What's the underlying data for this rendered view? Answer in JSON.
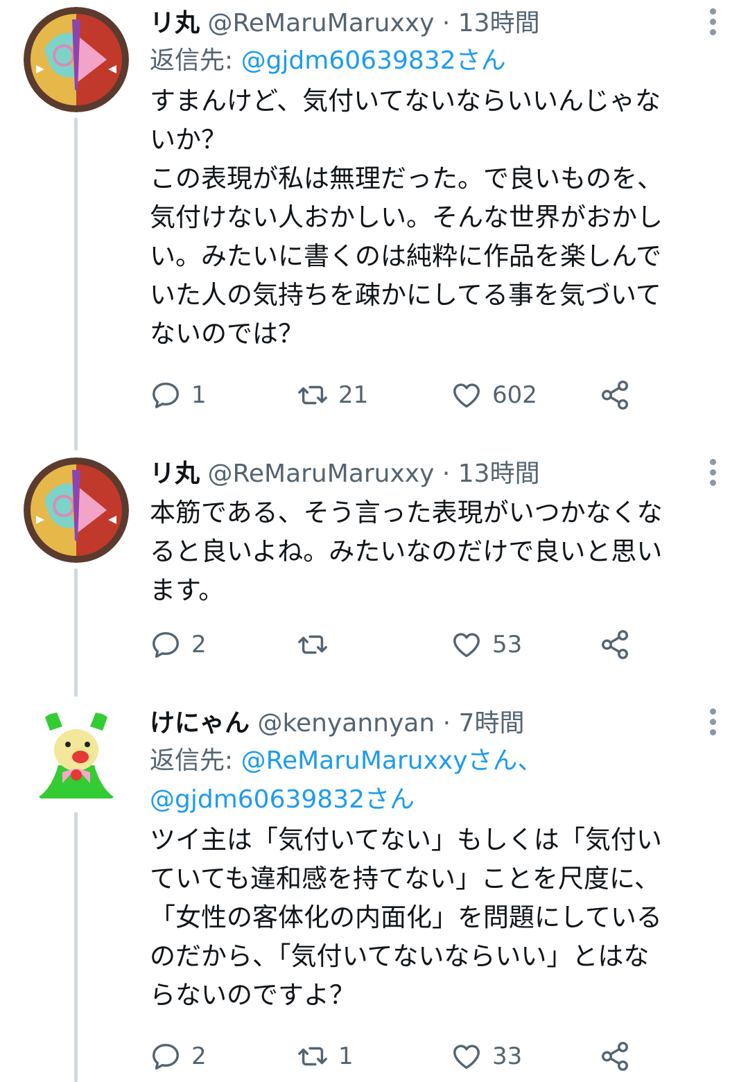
{
  "tweets": [
    {
      "name": "リ丸",
      "handle": "@ReMaruMaruxxy",
      "dot": "·",
      "time": "13時間",
      "reply_prefix": "返信先: ",
      "reply_to": "@gjdm60639832さん",
      "body": "すまんけど、気付いてないならいいんじゃな\nいか？\nこの表現が私は無理だった。で良いものを、\n気付けない人おかしい。そんな世界がおかし\nい。みたいに書くのは純粋に作品を楽しんで\nいた人の気持ちを疎かにしてる事を気づいて\nないのでは？",
      "replies": "1",
      "retweets": "21",
      "likes": "602"
    },
    {
      "name": "リ丸",
      "handle": "@ReMaruMaruxxy",
      "dot": "·",
      "time": "13時間",
      "body": "本筋である、そう言った表現がいつかなくな\nると良いよね。みたいなのだけで良いと思い\nます。",
      "replies": "2",
      "retweets": "",
      "likes": "53"
    },
    {
      "name": "けにゃん",
      "handle": "@kenyannyan",
      "dot": "·",
      "time": "7時間",
      "reply_prefix": "返信先: ",
      "reply_to": "@ReMaruMaruxxyさん、",
      "reply_to_2": "@gjdm60639832さん",
      "body": "ツイ主は「気付いてない」もしくは「気付い\nていても違和感を持てない」ことを尺度に、\n「女性の客体化の内面化」を問題にしている\nのだから、「気付いてないならいい」とはな\nらないのですよ？",
      "replies": "2",
      "retweets": "1",
      "likes": "33"
    }
  ],
  "icons": {
    "reply": "reply-icon",
    "retweet": "retweet-icon",
    "like": "heart-icon",
    "share": "share-icon",
    "more": "more-vertical-icon"
  },
  "colors": {
    "link": "#1d9bf0",
    "secondary": "#536471",
    "thread_line": "#cfd9de"
  }
}
